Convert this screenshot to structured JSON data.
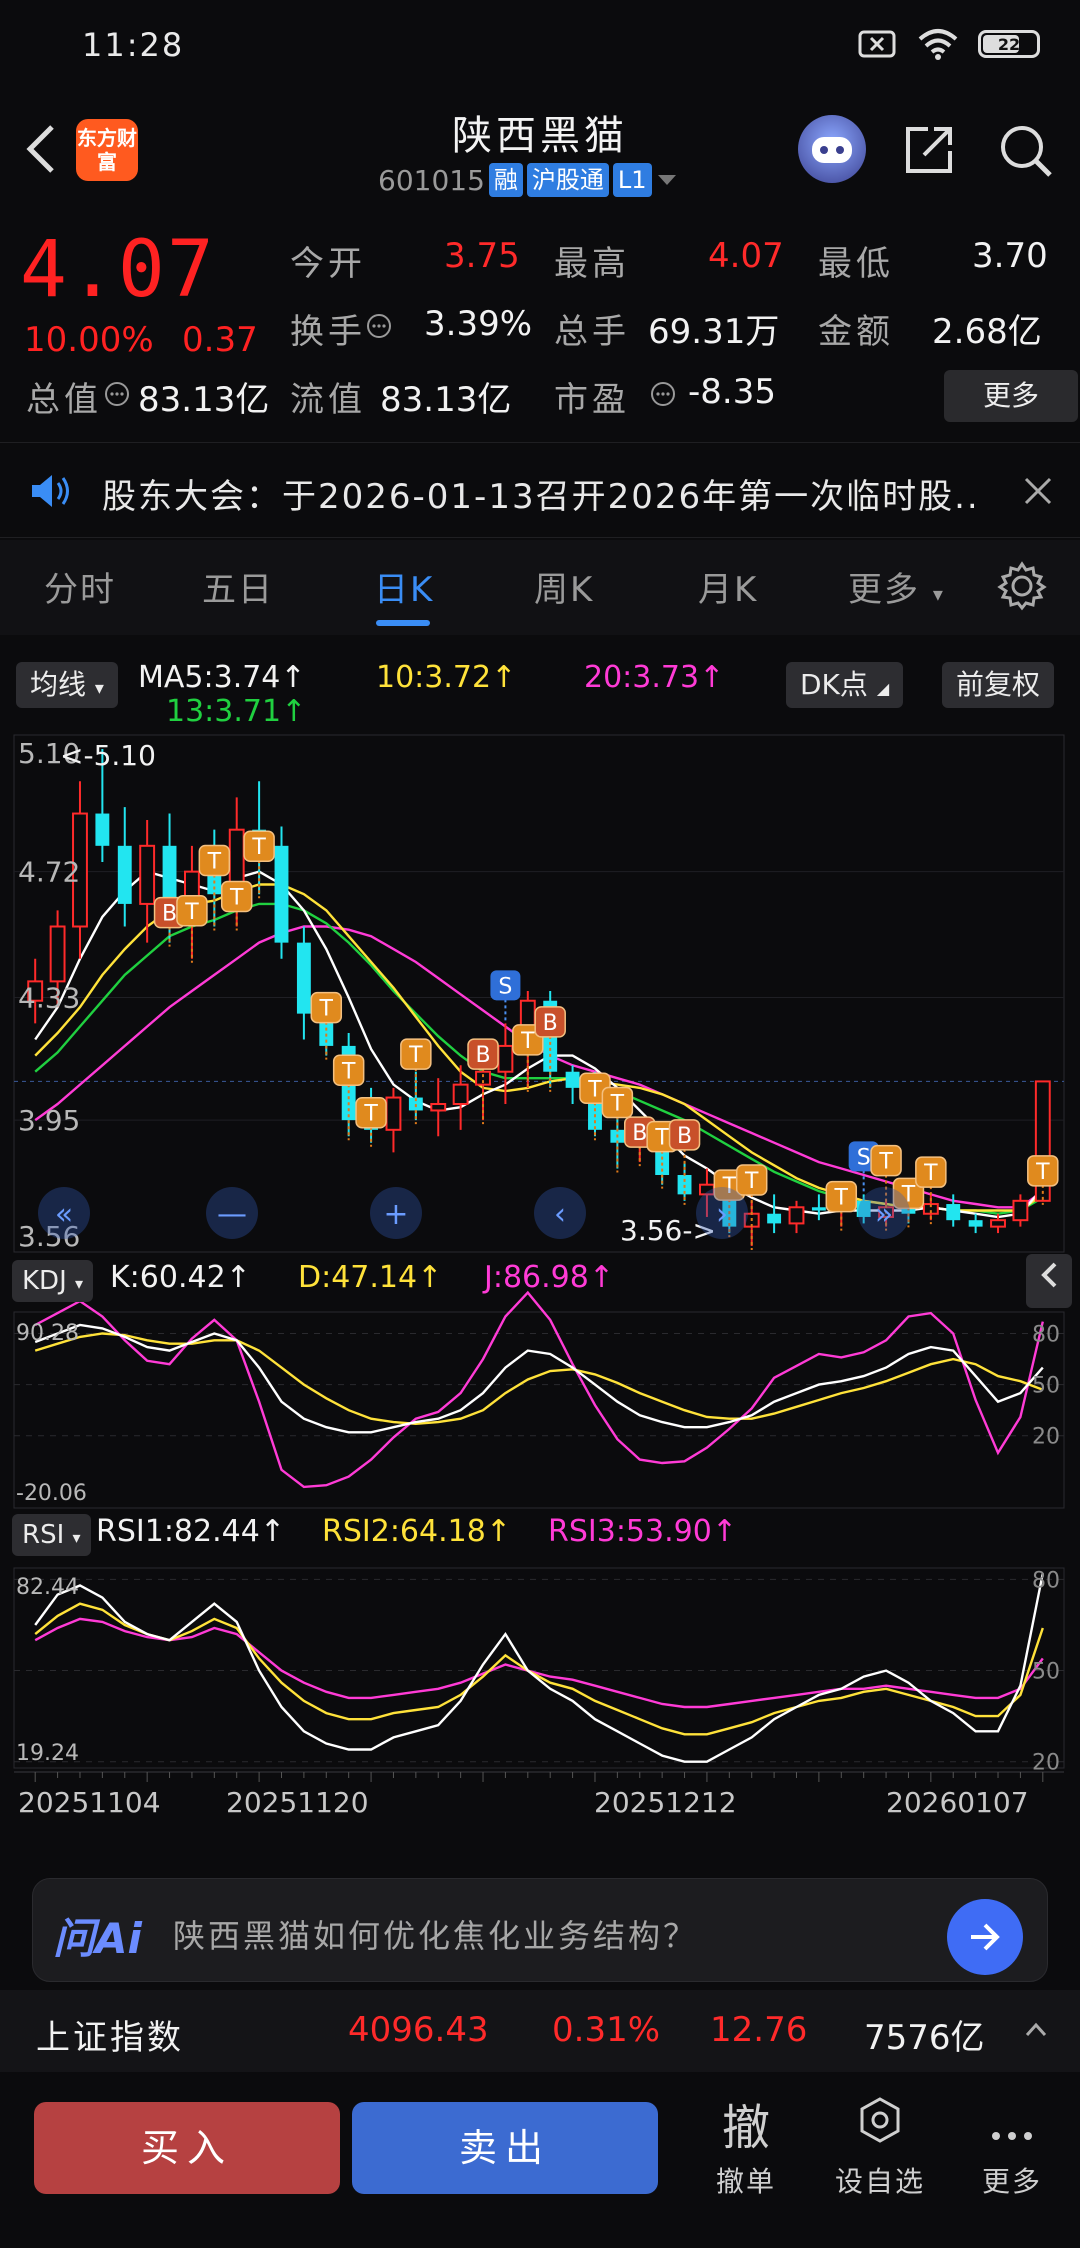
{
  "status": {
    "time": "11:28",
    "battery": "22"
  },
  "header": {
    "stock_name": "陕西黑猫",
    "stock_code": "601015",
    "tags": [
      "融",
      "沪股通",
      "L1"
    ],
    "logo_text": "东方财富"
  },
  "quote": {
    "price": "4.07",
    "change_pct": "10.00%",
    "change": "0.37",
    "open_label": "今开",
    "open": "3.75",
    "high_label": "最高",
    "high": "4.07",
    "low_label": "最低",
    "low": "3.70",
    "turnover_label": "换手",
    "turnover": "3.39%",
    "volume_label": "总手",
    "volume": "69.31万",
    "amount_label": "金额",
    "amount": "2.68亿",
    "mcap_label": "总值",
    "mcap": "83.13亿",
    "float_label": "流值",
    "float": "83.13亿",
    "pe_label": "市盈",
    "pe": "-8.35",
    "more_label": "更多"
  },
  "notice": {
    "text": "股东大会：于2026-01-13召开2026年第一次临时股.."
  },
  "tabs": [
    "分时",
    "五日",
    "日K",
    "周K",
    "月K",
    "更多"
  ],
  "active_tab": "日K",
  "chart_controls": {
    "ma_label": "均线",
    "ma5": "MA5:3.74↑",
    "ma10": "10:3.72↑",
    "ma20": "20:3.73↑",
    "ma13": "13:3.71↑",
    "dk_label": "DK点",
    "fq_label": "前复权",
    "kdj_label": "KDJ",
    "kdj_k": "K:60.42↑",
    "kdj_d": "D:47.14↑",
    "kdj_j": "J:86.98↑",
    "rsi_label": "RSI",
    "rsi1": "RSI1:82.44↑",
    "rsi2": "RSI2:64.18↑",
    "rsi3": "RSI3:53.90↑",
    "high_marker": "5.10",
    "low_marker": "3.56"
  },
  "chart_data": {
    "type": "candlestick",
    "axis_labels": [
      "5.10",
      "4.72",
      "4.33",
      "3.95",
      "3.56"
    ],
    "kdj_axis": [
      "90.28",
      "-20.06"
    ],
    "kdj_right": [
      "80",
      "50",
      "20"
    ],
    "rsi_axis": [
      "82.44",
      "19.24"
    ],
    "rsi_right": [
      "80",
      "50",
      "20"
    ],
    "dates": [
      "20251104",
      "20251120",
      "20251212",
      "20260107"
    ],
    "ohlc": [
      [
        4.32,
        4.45,
        4.25,
        4.38
      ],
      [
        4.38,
        4.6,
        4.3,
        4.55
      ],
      [
        4.55,
        5.0,
        4.45,
        4.9
      ],
      [
        4.9,
        5.1,
        4.75,
        4.8
      ],
      [
        4.8,
        4.92,
        4.55,
        4.62
      ],
      [
        4.62,
        4.88,
        4.5,
        4.8
      ],
      [
        4.8,
        4.9,
        4.5,
        4.58
      ],
      [
        4.58,
        4.8,
        4.45,
        4.72
      ],
      [
        4.72,
        4.85,
        4.55,
        4.65
      ],
      [
        4.65,
        4.95,
        4.55,
        4.85
      ],
      [
        4.85,
        5.0,
        4.65,
        4.8
      ],
      [
        4.8,
        4.86,
        4.45,
        4.5
      ],
      [
        4.5,
        4.55,
        4.2,
        4.28
      ],
      [
        4.28,
        4.32,
        4.15,
        4.18
      ],
      [
        4.18,
        4.22,
        3.9,
        3.95
      ],
      [
        3.95,
        4.05,
        3.88,
        3.92
      ],
      [
        3.92,
        4.05,
        3.85,
        4.02
      ],
      [
        4.02,
        4.1,
        3.95,
        3.98
      ],
      [
        3.98,
        4.08,
        3.9,
        4.0
      ],
      [
        4.0,
        4.12,
        3.92,
        4.06
      ],
      [
        4.06,
        4.12,
        3.95,
        4.1
      ],
      [
        4.1,
        4.25,
        4.0,
        4.18
      ],
      [
        4.18,
        4.35,
        4.05,
        4.32
      ],
      [
        4.32,
        4.35,
        4.05,
        4.1
      ],
      [
        4.1,
        4.12,
        4.0,
        4.05
      ],
      [
        4.05,
        4.1,
        3.9,
        3.92
      ],
      [
        3.92,
        3.98,
        3.8,
        3.88
      ],
      [
        3.88,
        3.95,
        3.82,
        3.9
      ],
      [
        3.9,
        3.92,
        3.75,
        3.78
      ],
      [
        3.78,
        3.82,
        3.7,
        3.72
      ],
      [
        3.72,
        3.8,
        3.65,
        3.75
      ],
      [
        3.75,
        3.78,
        3.6,
        3.62
      ],
      [
        3.62,
        3.7,
        3.56,
        3.66
      ],
      [
        3.66,
        3.72,
        3.6,
        3.63
      ],
      [
        3.63,
        3.7,
        3.6,
        3.68
      ],
      [
        3.68,
        3.72,
        3.64,
        3.67
      ],
      [
        3.67,
        3.72,
        3.62,
        3.7
      ],
      [
        3.7,
        3.72,
        3.63,
        3.65
      ],
      [
        3.65,
        3.7,
        3.62,
        3.68
      ],
      [
        3.68,
        3.7,
        3.63,
        3.66
      ],
      [
        3.66,
        3.72,
        3.64,
        3.69
      ],
      [
        3.69,
        3.72,
        3.62,
        3.64
      ],
      [
        3.64,
        3.66,
        3.6,
        3.62
      ],
      [
        3.62,
        3.66,
        3.6,
        3.64
      ],
      [
        3.64,
        3.72,
        3.62,
        3.7
      ],
      [
        3.7,
        4.07,
        3.7,
        4.07
      ]
    ],
    "ma5": [
      4.2,
      4.3,
      4.45,
      4.58,
      4.66,
      4.72,
      4.7,
      4.68,
      4.66,
      4.7,
      4.72,
      4.68,
      4.6,
      4.48,
      4.33,
      4.17,
      4.06,
      4.01,
      3.98,
      3.99,
      4.03,
      4.06,
      4.11,
      4.15,
      4.15,
      4.11,
      4.05,
      3.98,
      3.91,
      3.84,
      3.8,
      3.75,
      3.71,
      3.68,
      3.67,
      3.66,
      3.67,
      3.67,
      3.67,
      3.67,
      3.68,
      3.67,
      3.66,
      3.65,
      3.66,
      3.74
    ],
    "ma10": [
      4.15,
      4.22,
      4.3,
      4.4,
      4.48,
      4.55,
      4.6,
      4.62,
      4.63,
      4.66,
      4.68,
      4.68,
      4.65,
      4.6,
      4.52,
      4.44,
      4.36,
      4.27,
      4.18,
      4.1,
      4.05,
      4.04,
      4.05,
      4.07,
      4.08,
      4.07,
      4.06,
      4.05,
      4.03,
      4.0,
      3.95,
      3.9,
      3.85,
      3.81,
      3.77,
      3.74,
      3.72,
      3.7,
      3.69,
      3.68,
      3.68,
      3.67,
      3.67,
      3.67,
      3.67,
      3.72
    ],
    "ma20": [
      3.95,
      4.0,
      4.06,
      4.12,
      4.18,
      4.24,
      4.3,
      4.35,
      4.4,
      4.45,
      4.5,
      4.53,
      4.55,
      4.55,
      4.54,
      4.52,
      4.48,
      4.44,
      4.39,
      4.34,
      4.29,
      4.24,
      4.19,
      4.15,
      4.12,
      4.1,
      4.08,
      4.06,
      4.03,
      4.0,
      3.97,
      3.94,
      3.91,
      3.88,
      3.85,
      3.82,
      3.8,
      3.78,
      3.76,
      3.74,
      3.72,
      3.7,
      3.69,
      3.68,
      3.68,
      3.73
    ],
    "ma13": [
      4.1,
      4.16,
      4.24,
      4.32,
      4.4,
      4.46,
      4.52,
      4.55,
      4.57,
      4.6,
      4.62,
      4.62,
      4.6,
      4.56,
      4.5,
      4.43,
      4.35,
      4.28,
      4.21,
      4.15,
      4.1,
      4.08,
      4.08,
      4.08,
      4.08,
      4.06,
      4.04,
      4.01,
      3.98,
      3.95,
      3.91,
      3.87,
      3.83,
      3.79,
      3.76,
      3.73,
      3.71,
      3.7,
      3.69,
      3.68,
      3.68,
      3.67,
      3.67,
      3.66,
      3.67,
      3.71
    ],
    "kdj_k": [
      75,
      80,
      85,
      83,
      78,
      72,
      70,
      75,
      80,
      76,
      60,
      40,
      30,
      25,
      22,
      22,
      25,
      28,
      30,
      35,
      45,
      60,
      70,
      68,
      60,
      50,
      40,
      32,
      28,
      25,
      25,
      28,
      32,
      40,
      45,
      50,
      52,
      55,
      60,
      68,
      72,
      70,
      55,
      40,
      45,
      60
    ],
    "kdj_d": [
      70,
      74,
      78,
      80,
      79,
      76,
      74,
      74,
      76,
      76,
      70,
      60,
      50,
      42,
      35,
      30,
      28,
      27,
      28,
      30,
      35,
      45,
      53,
      58,
      59,
      56,
      51,
      45,
      40,
      35,
      31,
      30,
      30,
      33,
      37,
      41,
      45,
      48,
      52,
      57,
      62,
      65,
      62,
      55,
      52,
      47
    ],
    "kdj_j": [
      85,
      92,
      99,
      90,
      76,
      64,
      62,
      77,
      88,
      76,
      40,
      0,
      -10,
      -9,
      -4,
      6,
      19,
      30,
      34,
      45,
      65,
      90,
      104,
      88,
      62,
      38,
      18,
      6,
      4,
      5,
      13,
      24,
      36,
      54,
      61,
      68,
      66,
      69,
      76,
      90,
      92,
      80,
      41,
      10,
      31,
      87
    ],
    "rsi1": [
      65,
      75,
      78,
      74,
      66,
      62,
      60,
      66,
      72,
      66,
      50,
      38,
      30,
      26,
      24,
      24,
      28,
      30,
      32,
      40,
      52,
      62,
      50,
      44,
      40,
      34,
      30,
      26,
      22,
      20,
      20,
      24,
      28,
      34,
      38,
      42,
      44,
      48,
      50,
      46,
      40,
      36,
      30,
      30,
      45,
      82
    ],
    "rsi2": [
      62,
      68,
      72,
      70,
      65,
      62,
      60,
      63,
      67,
      64,
      54,
      46,
      40,
      36,
      34,
      34,
      36,
      37,
      38,
      42,
      48,
      55,
      50,
      46,
      44,
      40,
      37,
      34,
      31,
      29,
      29,
      31,
      33,
      36,
      38,
      40,
      41,
      43,
      44,
      42,
      40,
      38,
      35,
      35,
      42,
      64
    ],
    "rsi3": [
      60,
      64,
      67,
      66,
      63,
      61,
      60,
      61,
      64,
      62,
      56,
      50,
      46,
      43,
      41,
      41,
      42,
      43,
      44,
      46,
      49,
      52,
      50,
      48,
      47,
      45,
      43,
      41,
      39,
      38,
      38,
      39,
      40,
      41,
      42,
      43,
      44,
      44,
      45,
      44,
      43,
      42,
      41,
      41,
      44,
      54
    ],
    "signals": [
      {
        "i": 6,
        "t": "B"
      },
      {
        "i": 7,
        "t": "T"
      },
      {
        "i": 8,
        "t": "T"
      },
      {
        "i": 9,
        "t": "T"
      },
      {
        "i": 10,
        "t": "T"
      },
      {
        "i": 13,
        "t": "T"
      },
      {
        "i": 14,
        "t": "T"
      },
      {
        "i": 15,
        "t": "T"
      },
      {
        "i": 17,
        "t": "T"
      },
      {
        "i": 20,
        "t": "B"
      },
      {
        "i": 21,
        "t": "S"
      },
      {
        "i": 22,
        "t": "T"
      },
      {
        "i": 23,
        "t": "B"
      },
      {
        "i": 25,
        "t": "T"
      },
      {
        "i": 26,
        "t": "T"
      },
      {
        "i": 27,
        "t": "B"
      },
      {
        "i": 28,
        "t": "T"
      },
      {
        "i": 29,
        "t": "B"
      },
      {
        "i": 31,
        "t": "T"
      },
      {
        "i": 32,
        "t": "T"
      },
      {
        "i": 36,
        "t": "T"
      },
      {
        "i": 37,
        "t": "S"
      },
      {
        "i": 38,
        "t": "T"
      },
      {
        "i": 39,
        "t": "T"
      },
      {
        "i": 40,
        "t": "T"
      },
      {
        "i": 45,
        "t": "T"
      }
    ]
  },
  "ai_bar": {
    "logo": "问Ai",
    "prompt": "陕西黑猫如何优化焦化业务结构？"
  },
  "index_bar": {
    "name": "上证指数",
    "value": "4096.43",
    "pct": "0.31%",
    "change": "12.76",
    "amount": "7576亿"
  },
  "bottom_bar": {
    "buy": "买入",
    "sell": "卖出",
    "cancel_icon": "撤",
    "cancel": "撤单",
    "watch": "设自选",
    "more": "更多"
  },
  "colors": {
    "up": "#ff2a2a",
    "down": "#22e5f0",
    "ma5": "#ffffff",
    "ma10": "#ffe23a",
    "ma20": "#ff3bd6",
    "ma13": "#20d040",
    "accent": "#3a8df5"
  }
}
